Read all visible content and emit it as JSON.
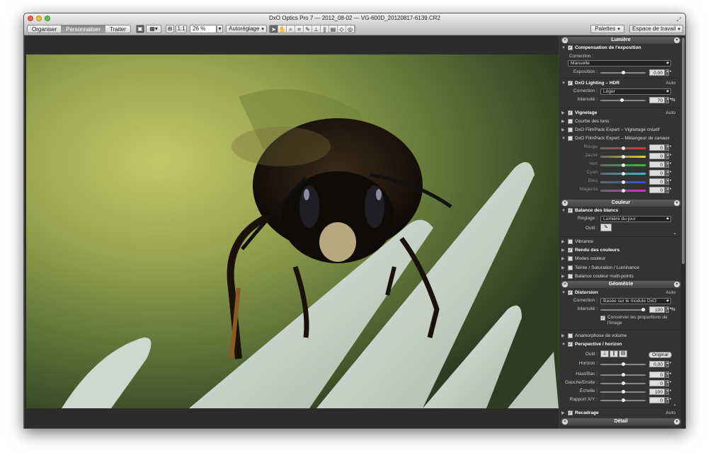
{
  "window": {
    "title": "DxO Optics Pro 7 — 2012_08-02 — VG-600D_20120817-6139.CR2"
  },
  "toolbar": {
    "modes": [
      "Organiser",
      "Personnaliser",
      "Traiter"
    ],
    "active_mode": "Personnaliser",
    "one_to_one": "1:1",
    "zoom": "26 %",
    "auto_preset": "Autoréglage",
    "palettes": "Palettes",
    "workspace": "Espace de travail"
  },
  "panel": {
    "lumiere": {
      "header": "Lumière",
      "exposure_comp": {
        "title": "Compensation de l'exposition",
        "correction_label": "Correction :",
        "correction_value": "Manuelle",
        "exposure_label": "Exposition :",
        "exposure_value": "0,00"
      },
      "lighting": {
        "title": "DxO Lighting – HDR",
        "auto": "Auto",
        "correction_label": "Correction :",
        "correction_value": "Léger",
        "intensity_label": "Intensité :",
        "intensity_value": "70"
      },
      "vignetting": {
        "title": "Vignetage",
        "auto": "Auto"
      },
      "tone_curve": "Courbe des tons",
      "filmpack_vignette": "DxO FilmPack Expert – Vignetage créatif",
      "filmpack_mixer": "DxO FilmPack Expert – Mélangeur de canaux",
      "channels": [
        {
          "label": "Rouge",
          "value": "0",
          "color": "#e03030"
        },
        {
          "label": "Jaune",
          "value": "0",
          "color": "#e0d030"
        },
        {
          "label": "Vert",
          "value": "0",
          "color": "#30c040"
        },
        {
          "label": "Cyan",
          "value": "0",
          "color": "#30c0d0"
        },
        {
          "label": "Bleu",
          "value": "0",
          "color": "#3050e0"
        },
        {
          "label": "Magenta",
          "value": "0",
          "color": "#d030d0"
        }
      ]
    },
    "couleur": {
      "header": "Couleur",
      "white_balance": {
        "title": "Balance des blancs",
        "setting_label": "Réglage :",
        "setting_value": "Lumière du jour",
        "tool_label": "Outil :"
      },
      "vibrance": "Vibrance",
      "color_rendering": "Rendu des couleurs",
      "color_modes": "Modes couleur",
      "hsl": "Teinte / Saturation / Luminance",
      "multipoint_balance": "Balance couleur multi-points"
    },
    "geometrie": {
      "header": "Géométrie",
      "distortion": {
        "title": "Distorsion",
        "auto": "Auto",
        "correction_label": "Correction :",
        "correction_value": "Basée sur le module DxO",
        "intensity_label": "Intensité :",
        "intensity_value": "100",
        "keep_proportions": "Conserver les proportions de l'image"
      },
      "volume": "Anamorphose de volume",
      "perspective": {
        "title": "Perspective / horizon",
        "tool_label": "Outil :",
        "original_label": "Original",
        "horizon_label": "Horizon :",
        "horizon_value": "0,00",
        "updown_label": "Haut/Bas :",
        "updown_value": "0",
        "leftright_label": "Gauche/Droite :",
        "leftright_value": "0",
        "scale_label": "Échelle :",
        "scale_value": "100",
        "ratio_label": "Rapport X/Y :",
        "ratio_value": "0"
      },
      "crop": {
        "title": "Recadrage",
        "auto": "Auto"
      }
    },
    "detail": {
      "header": "Détail"
    }
  }
}
